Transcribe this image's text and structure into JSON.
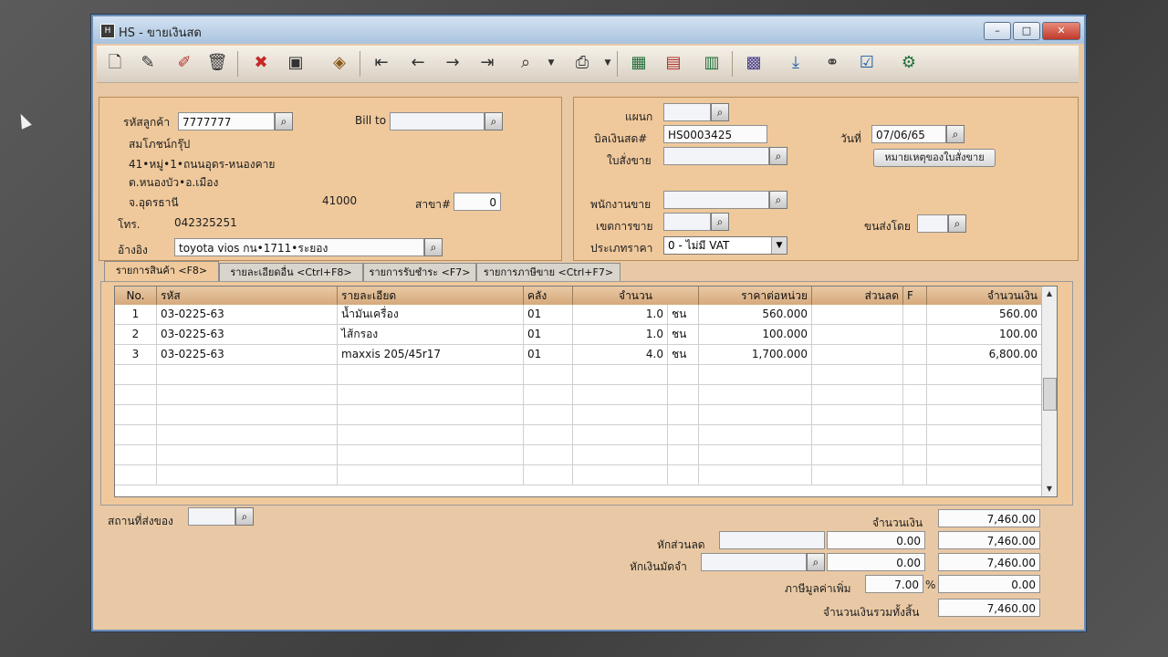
{
  "window": {
    "title": "HS - ขายเงินสด",
    "controls": {
      "minimize": "–",
      "maximize": "□",
      "close": "✕"
    }
  },
  "toolbar": {
    "icons": [
      "new-icon",
      "edit-icon",
      "edit-doc-icon",
      "delete-icon",
      "cancel-icon",
      "save-icon",
      "batch-icon",
      "first-icon",
      "prev-icon",
      "next-icon",
      "last-icon",
      "search-doc-icon",
      "print-icon",
      "report-icon",
      "calc-icon",
      "chart-icon",
      "calendar-icon",
      "import-icon",
      "link-icon",
      "approve-icon",
      "tools-icon"
    ]
  },
  "customer": {
    "code_label": "รหัสลูกค้า",
    "code": "7777777",
    "billto_label": "Bill to",
    "billto": "",
    "name": "สมโภชน์กรุ๊ป",
    "address1": "41•หมู่•1•ถนนอุดร-หนองคาย",
    "address2": "ต.หนองบัว•อ.เมือง",
    "province": "จ.อุดรธานี",
    "zip": "41000",
    "branch_label": "สาขา#",
    "branch": "0",
    "phone_label": "โทร.",
    "phone": "042325251",
    "ref_label": "อ้างอิง",
    "ref": "toyota vios กน•1711•ระยอง"
  },
  "doc": {
    "dept_label": "แผนก",
    "dept": "",
    "bill_label": "บิลเงินสด#",
    "bill": "HS0003425",
    "date_label": "วันที่",
    "date": "07/06/65",
    "order_label": "ใบสั่งขาย",
    "order": "",
    "note_button": "หมายเหตุของใบสั่งขาย",
    "salesman_label": "พนักงานขาย",
    "salesman": "",
    "area_label": "เขตการขาย",
    "area": "",
    "ship_label": "ขนส่งโดย",
    "ship": "",
    "price_type_label": "ประเภทราคา",
    "price_type": "0 - ไม่มี VAT"
  },
  "tabs": [
    {
      "label": "รายการสินค้า <F8>"
    },
    {
      "label": "รายละเอียดอื่น <Ctrl+F8>"
    },
    {
      "label": "รายการรับชำระ <F7>"
    },
    {
      "label": "รายการภาษีขาย <Ctrl+F7>"
    }
  ],
  "table": {
    "headers": {
      "no": "No.",
      "code": "รหัส",
      "desc": "รายละเอียด",
      "store": "คลัง",
      "qty": "จำนวน",
      "price": "ราคาต่อหน่วย",
      "disc": "ส่วนลด",
      "f": "F",
      "amount": "จำนวนเงิน"
    },
    "rows": [
      {
        "no": "1",
        "code": "03-0225-63",
        "desc": "น้ำมันเครื่อง",
        "store": "01",
        "qty": "1.0",
        "unit": "ชน",
        "price": "560.000",
        "disc": "",
        "f": "",
        "amount": "560.00"
      },
      {
        "no": "2",
        "code": "03-0225-63",
        "desc": "ไส้กรอง",
        "store": "01",
        "qty": "1.0",
        "unit": "ชน",
        "price": "100.000",
        "disc": "",
        "f": "",
        "amount": "100.00"
      },
      {
        "no": "3",
        "code": "03-0225-63",
        "desc": "maxxis 205/45r17",
        "store": "01",
        "qty": "4.0",
        "unit": "ชน",
        "price": "1,700.000",
        "disc": "",
        "f": "",
        "amount": "6,800.00"
      }
    ]
  },
  "footer": {
    "ship_place_label": "สถานที่ส่งของ",
    "ship_place": "",
    "amount_label": "จำนวนเงิน",
    "amount": "7,460.00",
    "discount_label": "หักส่วนลด",
    "discount_text": "",
    "discount": "0.00",
    "after_discount": "7,460.00",
    "deposit_label": "หักเงินมัดจำ",
    "deposit_ref": "",
    "deposit": "0.00",
    "after_deposit": "7,460.00",
    "vat_label": "ภาษีมูลค่าเพิ่ม",
    "vat_rate": "7.00",
    "vat_pct": "%",
    "vat": "0.00",
    "total_label": "จำนวนเงินรวมทั้งสิ้น",
    "total": "7,460.00"
  }
}
